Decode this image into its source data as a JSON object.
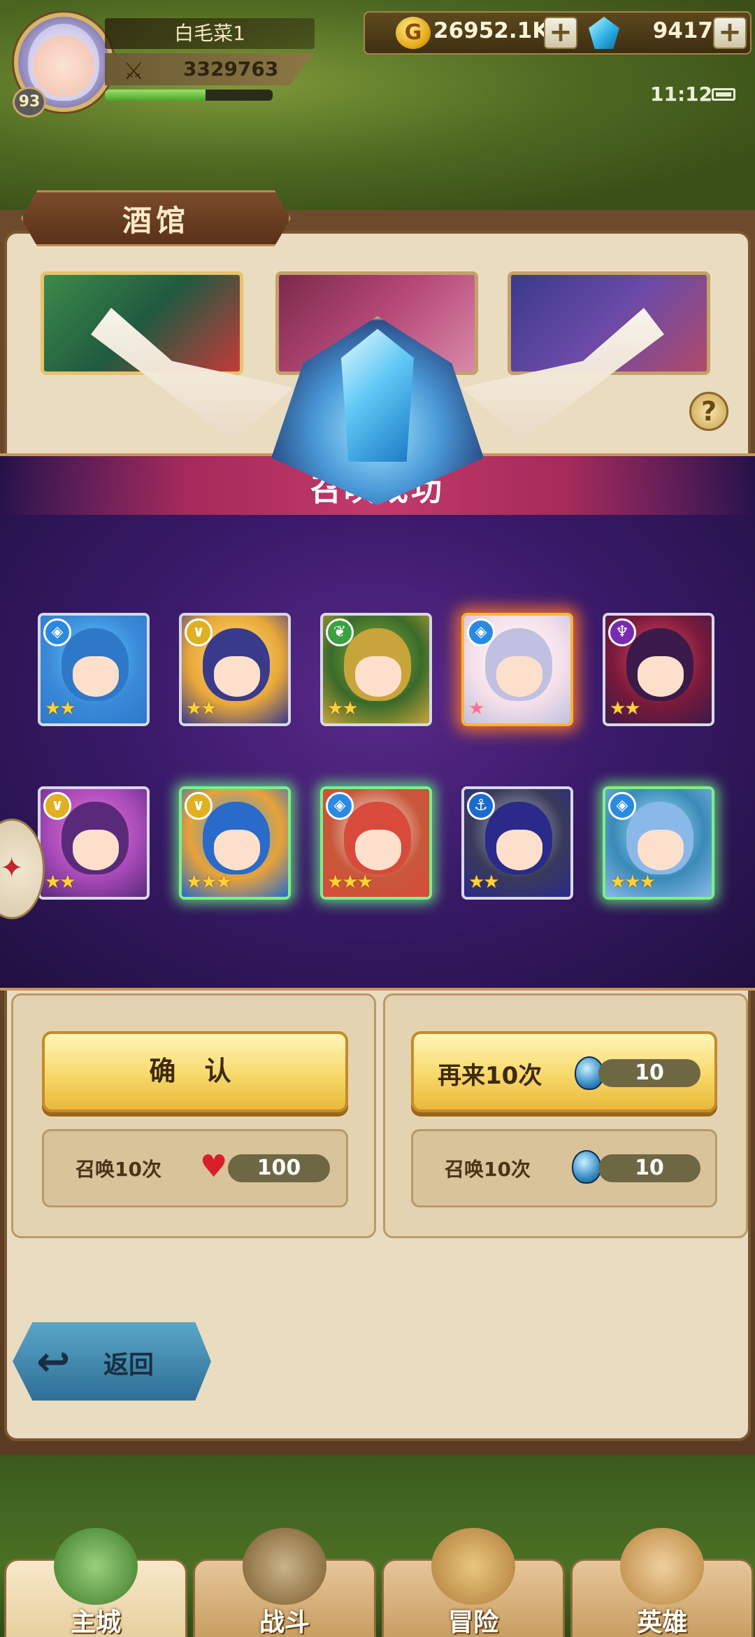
{
  "player": {
    "name": "白毛菜1",
    "level": "93",
    "power": "3329763",
    "exp_fraction": 0.6
  },
  "resources": {
    "gold": "26952.1K",
    "gems": "9417"
  },
  "status_bar": {
    "time": "11:12"
  },
  "tavern": {
    "title": "酒馆",
    "help_label": "?"
  },
  "summon_result": {
    "title": "召唤成功",
    "heroes": [
      {
        "faction": "water",
        "stars": 2,
        "glow": "none"
      },
      {
        "faction": "light",
        "stars": 2,
        "glow": "none"
      },
      {
        "faction": "nature",
        "stars": 2,
        "glow": "none"
      },
      {
        "faction": "water",
        "stars": 1,
        "glow": "gold"
      },
      {
        "faction": "dark",
        "stars": 2,
        "glow": "none"
      },
      {
        "faction": "light",
        "stars": 2,
        "glow": "none"
      },
      {
        "faction": "light",
        "stars": 3,
        "glow": "green"
      },
      {
        "faction": "water",
        "stars": 3,
        "glow": "green"
      },
      {
        "faction": "anchor",
        "stars": 2,
        "glow": "none"
      },
      {
        "faction": "water",
        "stars": 3,
        "glow": "green"
      }
    ]
  },
  "actions": {
    "confirm_label": "确 认",
    "again_label": "再来10次",
    "again_cost": "10",
    "summon_left_label": "召唤10次",
    "summon_left_cost": "100",
    "summon_right_label": "召唤10次",
    "summon_right_cost": "10",
    "back_label": "返回"
  },
  "nav": {
    "tabs": [
      {
        "label": "主城",
        "active": true
      },
      {
        "label": "战斗",
        "active": false
      },
      {
        "label": "冒险",
        "active": false
      },
      {
        "label": "英雄",
        "active": false
      }
    ]
  },
  "colors": {
    "accent_gold": "#f7d86a",
    "overlay_purple": "#3a1a6a",
    "header_magenta": "#c23a6a"
  }
}
